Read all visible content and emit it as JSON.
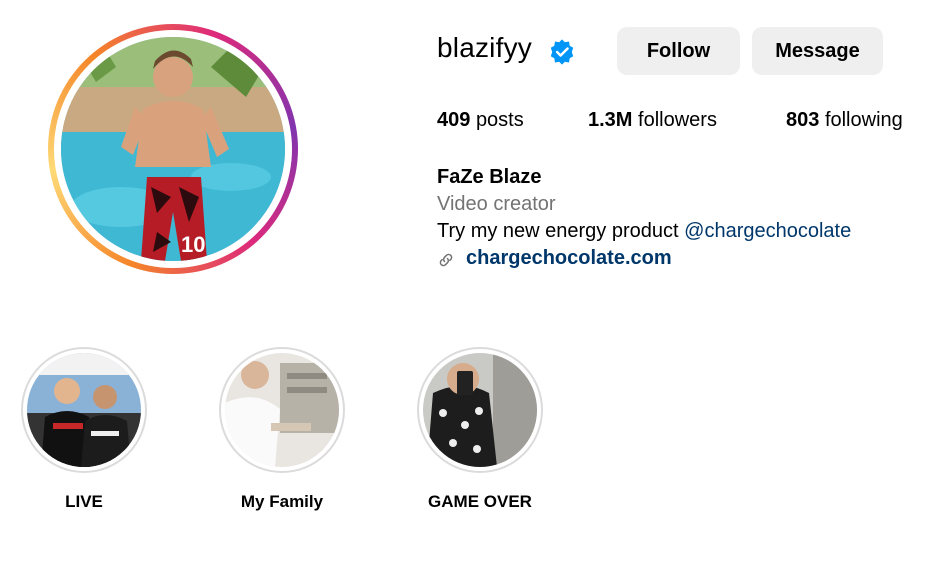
{
  "profile": {
    "username": "blazifyy",
    "verified_icon": "verified-badge-icon",
    "follow_label": "Follow",
    "message_label": "Message",
    "stats": {
      "posts_count": "409",
      "posts_label": "posts",
      "followers_count": "1.3M",
      "followers_label": "followers",
      "following_count": "803",
      "following_label": "following"
    },
    "name": "FaZe Blaze",
    "category": "Video creator",
    "bio_text": "Try my new energy product ",
    "bio_mention": "@chargechocolate",
    "link_icon": "link-icon",
    "link_text": "chargechocolate.com"
  },
  "highlights": [
    {
      "label": "LIVE"
    },
    {
      "label": "My Family"
    },
    {
      "label": "GAME OVER"
    }
  ],
  "colors": {
    "button_bg": "#efefef",
    "link": "#00376b",
    "secondary_text": "#737373",
    "verified": "#0095f6"
  }
}
